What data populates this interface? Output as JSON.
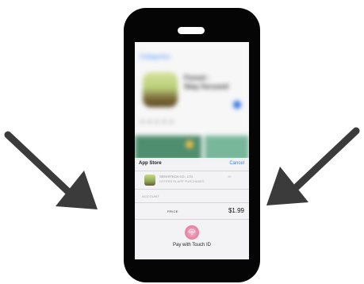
{
  "blurred_background": {
    "back_link": "Categories",
    "app_title_line1": "Forest -",
    "app_title_line2": "Stay focused",
    "rating_text": "★★★★★"
  },
  "payment_sheet": {
    "title": "App Store",
    "cancel_label": "Cancel",
    "merchant_name": "SEEKRTECH CO., LTD.",
    "merchant_sub": "OFFERS IN-APP PURCHASES",
    "age_badge": "4+",
    "account_label": "ACCOUNT",
    "price_label": "PRICE",
    "price_value": "$1.99",
    "touch_id_label": "Pay with Touch ID"
  },
  "colors": {
    "phone_body": "#050505",
    "arrow": "#3b3b3b",
    "link_blue": "#3b82f6",
    "touch_id_pink": "#e98aa7"
  },
  "icons": {
    "left_arrow": "arrow-down-right-icon",
    "right_arrow": "arrow-down-left-icon",
    "fingerprint": "touch-id-fingerprint-icon"
  }
}
